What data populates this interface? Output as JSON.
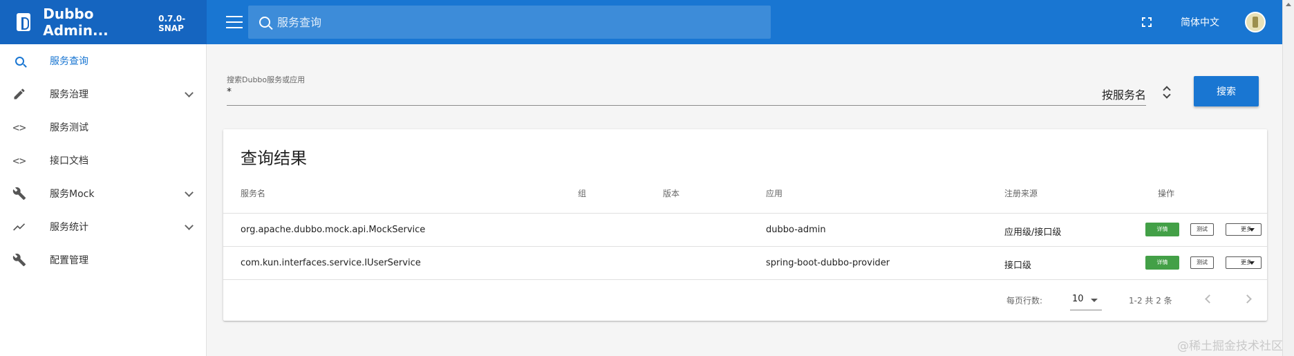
{
  "app": {
    "title": "Dubbo Admin...",
    "version": "0.7.0-SNAP"
  },
  "topbar": {
    "search_placeholder": "服务查询",
    "language": "简体中文"
  },
  "sidebar": {
    "items": [
      {
        "label": "服务查询",
        "icon": "search-icon",
        "active": true,
        "expandable": false
      },
      {
        "label": "服务治理",
        "icon": "pencil-icon",
        "active": false,
        "expandable": true
      },
      {
        "label": "服务测试",
        "icon": "code-icon",
        "active": false,
        "expandable": false
      },
      {
        "label": "接口文档",
        "icon": "code-icon",
        "active": false,
        "expandable": false
      },
      {
        "label": "服务Mock",
        "icon": "wrench-icon",
        "active": false,
        "expandable": true
      },
      {
        "label": "服务统计",
        "icon": "trending-up-icon",
        "active": false,
        "expandable": true
      },
      {
        "label": "配置管理",
        "icon": "wrench-icon",
        "active": false,
        "expandable": false
      }
    ]
  },
  "filter": {
    "label": "搜索Dubbo服务或应用",
    "value": "*",
    "sort_by": "按服务名",
    "search_button": "搜索"
  },
  "results": {
    "title": "查询结果",
    "columns": [
      "服务名",
      "组",
      "版本",
      "应用",
      "注册来源",
      "操作"
    ],
    "rows": [
      {
        "service": "org.apache.dubbo.mock.api.MockService",
        "group": "",
        "version": "",
        "app": "dubbo-admin",
        "source": "应用级/接口级"
      },
      {
        "service": "com.kun.interfaces.service.IUserService",
        "group": "",
        "version": "",
        "app": "spring-boot-dubbo-provider",
        "source": "接口级"
      }
    ],
    "actions": {
      "detail": "详情",
      "test": "测试",
      "more": "更多"
    },
    "pagination": {
      "rows_per_page_label": "每页行数:",
      "rows_per_page": "10",
      "range": "1-2 共 2 条"
    }
  },
  "watermark": "@稀土掘金技术社区",
  "colors": {
    "primary": "#1976d2",
    "brand": "#1565c0",
    "detail_button": "#43a047"
  }
}
